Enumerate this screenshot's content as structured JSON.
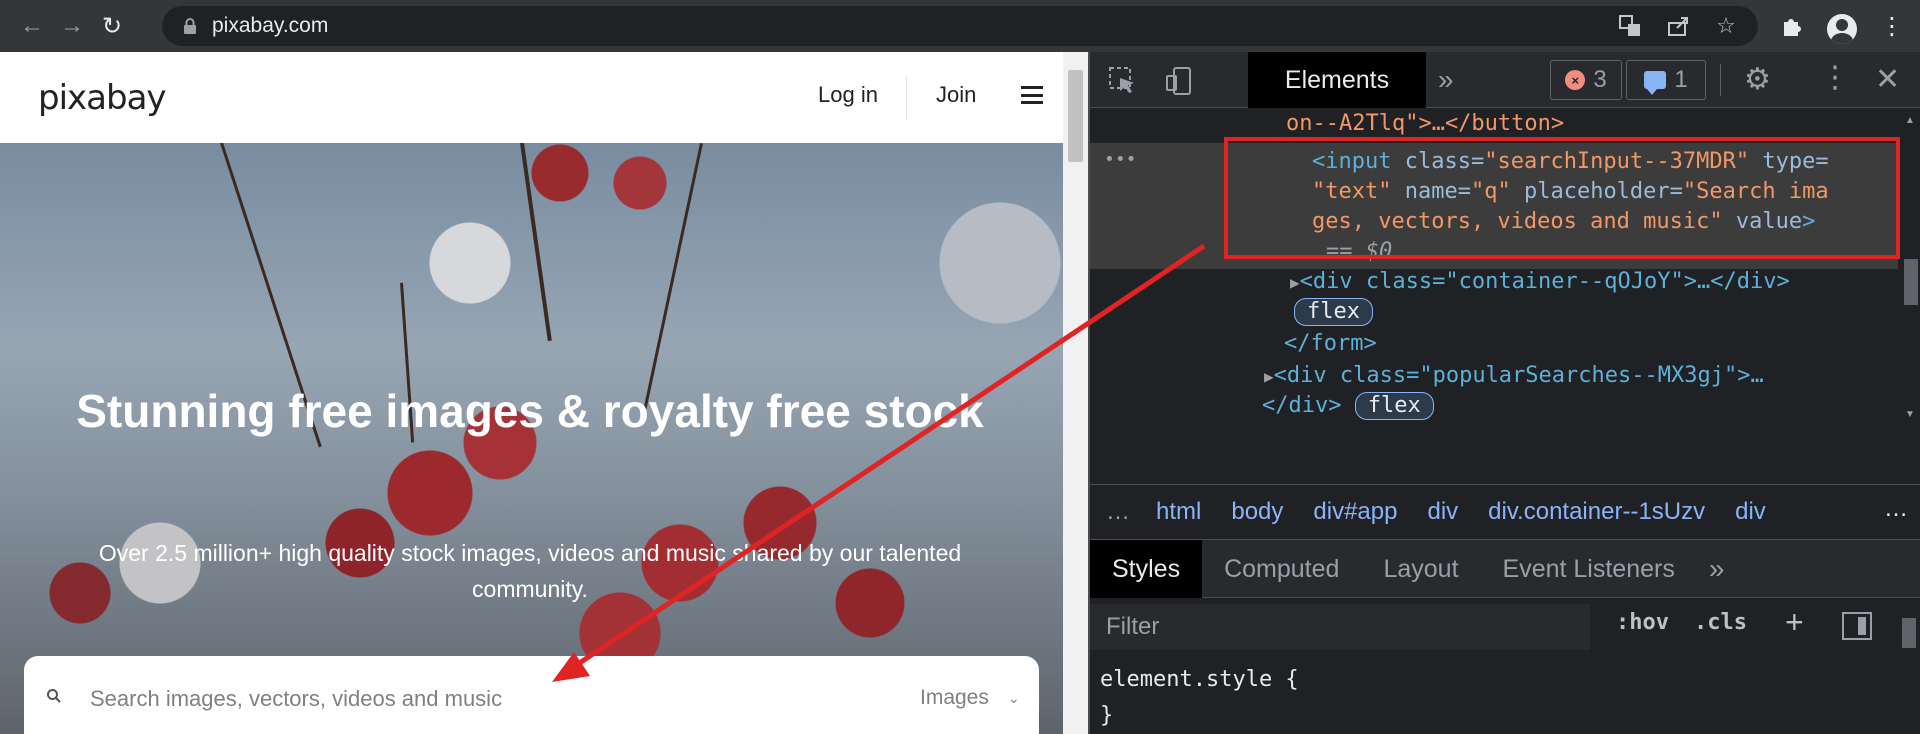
{
  "browser": {
    "url": "pixabay.com"
  },
  "site": {
    "logo": "pixabay",
    "login": "Log in",
    "join": "Join",
    "hero_title": "Stunning free images & royalty free stock",
    "hero_subtitle": "Over 2.5 million+ high quality stock images, videos and music shared by our talented community.",
    "search_placeholder": "Search images, vectors, videos and music",
    "search_type": "Images"
  },
  "devtools": {
    "tab_elements": "Elements",
    "errors": "3",
    "messages": "1",
    "dom_lines": [
      "on--A2Tlq\">…</button>",
      "== $0",
      "<div class=\"container--qOJoY\">…</div>",
      "flex",
      "</form>",
      "<div class=\"popularSearches--MX3gj\">…",
      "</div>",
      "flex"
    ],
    "selected_input": {
      "line1_tag": "<input",
      "line1_attr1": "class=",
      "line1_val1": "\"searchInput--37MDR\"",
      "line1_attr2": "type=",
      "line2_val1": "\"text\"",
      "line2_attr1": "name=",
      "line2_val2": "\"q\"",
      "line2_attr2": "placeholder=",
      "line2_val3": "\"Search ima",
      "line3_val": "ges, vectors, videos and music\"",
      "line3_attr": "value",
      "line3_end": ">"
    },
    "breadcrumbs": [
      "html",
      "body",
      "div#app",
      "div",
      "div.container--1sUzv",
      "div"
    ],
    "styles_tabs": [
      "Styles",
      "Computed",
      "Layout",
      "Event Listeners"
    ],
    "filter_placeholder": "Filter",
    "hov": ":hov",
    "cls": ".cls",
    "style_rule_selector": "element.style {",
    "style_rule_close": "}"
  },
  "colors": {
    "annotation": "#e02424",
    "devtools_bg": "#202124",
    "tag": "#5db0d7",
    "attr_value": "#f29766"
  }
}
